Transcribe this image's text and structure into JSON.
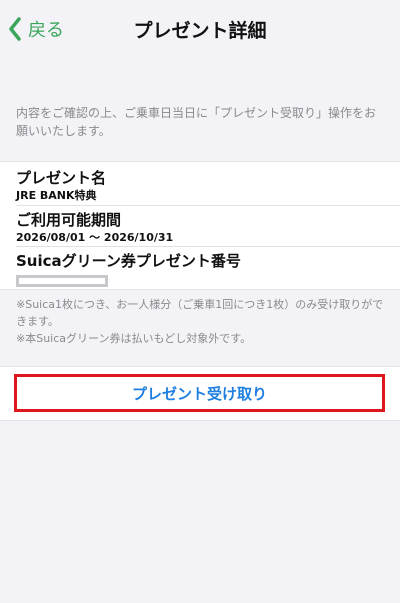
{
  "nav": {
    "back_label": "戻る",
    "title": "プレゼント詳細"
  },
  "notice": "内容をご確認の上、ご乗車日当日に「プレゼント受取り」操作をお願いいたします。",
  "details": {
    "present_name_label": "プレゼント名",
    "present_name_value": "JRE BANK特典",
    "period_label": "ご利用可能期間",
    "period_value": "2026/08/01 ～ 2026/10/31",
    "code_label": "Suicaグリーン券プレゼント番号"
  },
  "footnotes": [
    "※Suica1枚につき、お一人様分（ご乗車1回につき1枚）のみ受け取りができます。",
    "※本Suicaグリーン券は払いもどし対象外です。"
  ],
  "action": {
    "receive_label": "プレゼント受け取り"
  },
  "colors": {
    "accent_green": "#3aa65a",
    "button_text_blue": "#1f7fe0",
    "highlight_red": "#e0161e",
    "background": "#f2f2f7"
  }
}
